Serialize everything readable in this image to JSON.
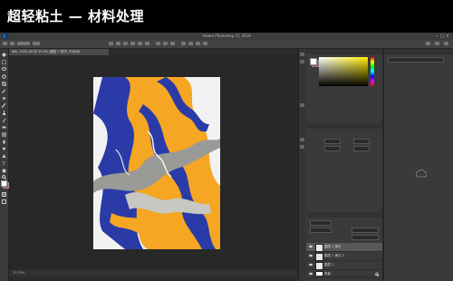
{
  "page_title": "超轻粘土 — 材料处理",
  "app": {
    "window_title": "Adobe Photoshop CC 2018",
    "menu": [
      "",
      "",
      "",
      "",
      "",
      "",
      "",
      "",
      "",
      "",
      ""
    ],
    "options_text": "",
    "document_tab": "WIL, 2332.40 @ 33.3% (图层 1 拷贝, RGB/8)",
    "zoom_level": "33.33%",
    "status_text": "",
    "panels": {
      "color_tab": "",
      "properties_tab": "",
      "properties_rows": [
        "",
        "",
        "",
        ""
      ],
      "layers_tab": "",
      "layers": [
        {
          "name": "图层 1 拷贝",
          "active": true
        },
        {
          "name": "图层 1 拷贝 2",
          "active": false
        },
        {
          "name": "图层 1",
          "active": false
        },
        {
          "name": "背景",
          "active": false
        }
      ]
    },
    "right_panel": {
      "tab": "",
      "cc_message": ""
    },
    "colors": {
      "foreground": "#ffffff",
      "background": "#d23a3a",
      "artwork_orange": "#f5a623",
      "artwork_blue": "#2a3ba8",
      "artwork_gray": "#9a9a96"
    }
  }
}
